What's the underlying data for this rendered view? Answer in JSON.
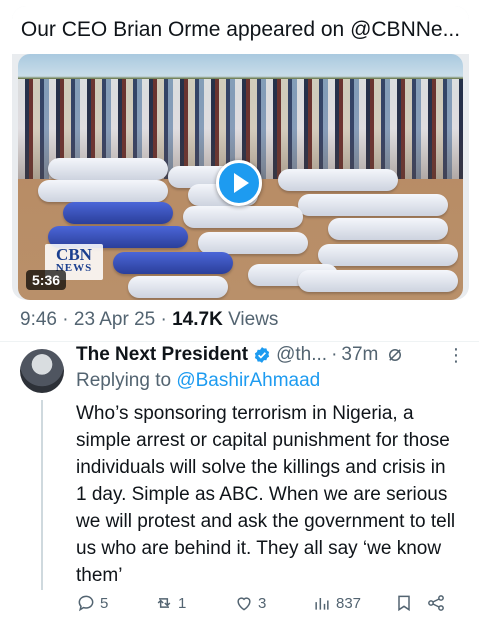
{
  "card": {
    "title": "Our CEO Brian Orme appeared on @CBNNe...",
    "video": {
      "duration": "5:36",
      "watermark_line1": "CBN",
      "watermark_line2": "NEWS"
    }
  },
  "post_meta": {
    "time": "9:46",
    "date": "23 Apr 25",
    "views_count": "14.7K",
    "views_label": "Views"
  },
  "reply": {
    "name": "The Next President",
    "handle": "@th...",
    "time": "37m",
    "replying_prefix": "Replying to",
    "replying_to": "@BashirAhmaad",
    "text": "Who’s sponsoring terrorism in Nigeria, a simple arrest or capital punishment for those individuals will solve the killings and crisis in 1 day. Simple as ABC. When we are serious we will protest and ask the government to tell us who are behind it. They all say ‘we know them’",
    "actions": {
      "replies": "5",
      "reposts": "1",
      "likes": "3",
      "views": "837"
    },
    "icons": {
      "verified": "verified-badge-icon",
      "grok": "grok-icon",
      "more": "more-icon",
      "reply": "reply-icon",
      "repost": "repost-icon",
      "like": "heart-icon",
      "views": "views-chart-icon",
      "bookmark": "bookmark-icon",
      "share": "share-icon"
    }
  },
  "colors": {
    "accent": "#1d9bf0",
    "text": "#0f1419",
    "secondary": "#536471"
  }
}
